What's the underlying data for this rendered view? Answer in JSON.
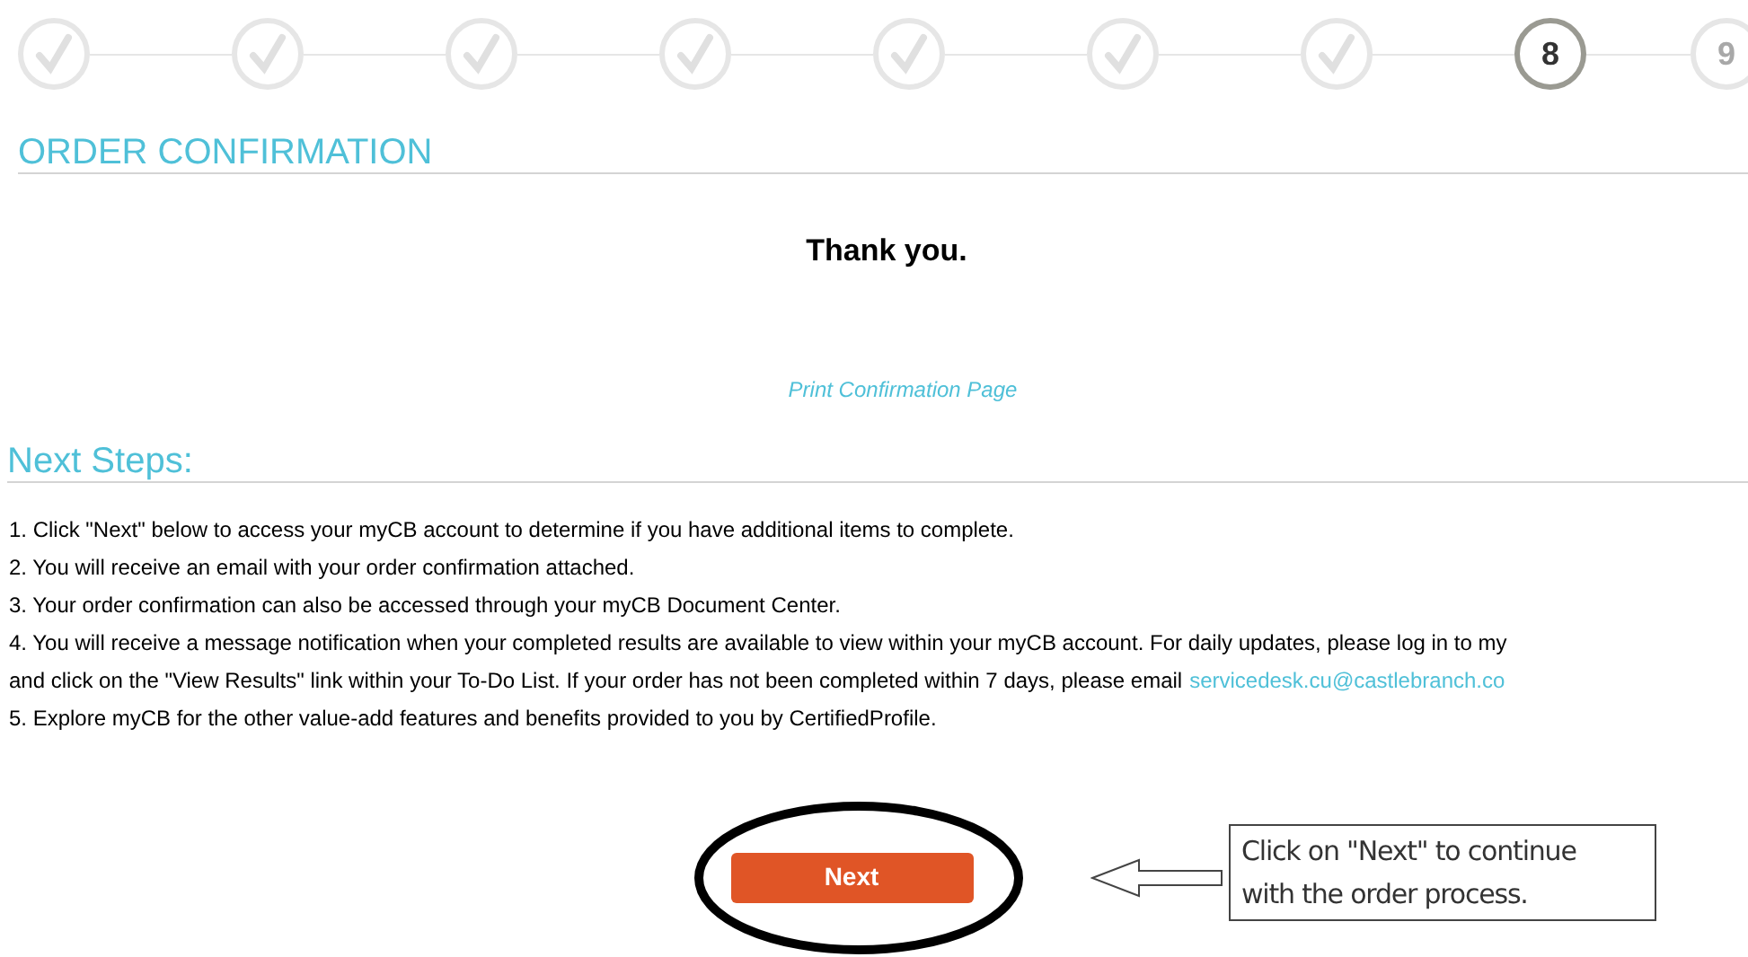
{
  "progress_steps": [
    {
      "kind": "done"
    },
    {
      "kind": "done"
    },
    {
      "kind": "done"
    },
    {
      "kind": "done"
    },
    {
      "kind": "done"
    },
    {
      "kind": "done"
    },
    {
      "kind": "done"
    },
    {
      "kind": "current",
      "label": "8"
    },
    {
      "kind": "upcoming",
      "label": "9"
    }
  ],
  "section_title": "ORDER CONFIRMATION",
  "thank_you": "Thank you.",
  "print_link": "Print Confirmation Page",
  "next_steps": {
    "title": "Next Steps:",
    "lines": [
      {
        "text": "1. Click \"Next\" below to access your myCB account to determine if you have additional items to complete."
      },
      {
        "text": "2. You will receive an email with your order confirmation attached."
      },
      {
        "text": "3. Your order confirmation can also be accessed through your myCB Document Center."
      },
      {
        "text": "4. You will receive a message notification when your completed results are available to view within your myCB account. For daily updates, please log in to my"
      },
      {
        "text": "and click on the \"View Results\" link within your To-Do List. If your order has not been completed within 7 days, please email",
        "link": "servicedesk.cu@castlebranch.co"
      },
      {
        "text": "5. Explore myCB for the other value-add features and benefits provided to you by CertifiedProfile."
      }
    ]
  },
  "next_button": "Next",
  "callout": "Click on \"Next\" to continue with the order process."
}
